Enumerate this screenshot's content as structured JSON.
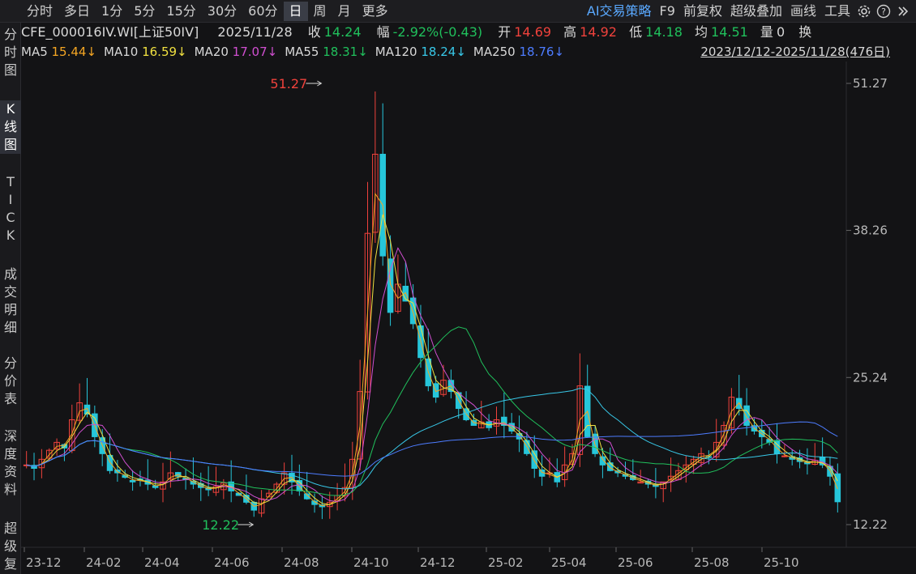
{
  "toolbar": {
    "periods": [
      "分时",
      "多日",
      "1分",
      "5分",
      "15分",
      "30分",
      "60分",
      "日",
      "周",
      "月",
      "更多"
    ],
    "active_period": "日",
    "ai_label": "AI交易策略",
    "f9_label": "F9",
    "fuquan_label": "前复权",
    "overlay_label": "超级叠加",
    "draw_label": "画线",
    "tools_label": "工具",
    "icons": [
      "gear-icon",
      "help-icon",
      "expand-icon"
    ]
  },
  "sidebar": {
    "tabs": [
      "分时图",
      "K线图",
      "TICK",
      "成交明细",
      "分价表",
      "深度资料",
      "超级复"
    ],
    "active": "K线图"
  },
  "info": {
    "symbol": "CFE_000016IV.WI[上证50IV]",
    "date": "2025/11/28",
    "close_label": "收",
    "close": "14.24",
    "change_label": "幅",
    "change": "-2.92%(-0.43)",
    "open_label": "开",
    "open": "14.69",
    "high_label": "高",
    "high": "14.92",
    "low_label": "低",
    "low": "14.18",
    "avg_label": "均",
    "avg": "14.51",
    "vol_label": "量",
    "vol": "0",
    "turnover_label": "换"
  },
  "ma": {
    "items": [
      {
        "label": "MA5",
        "value": "15.44↓",
        "color": "#f5a623"
      },
      {
        "label": "MA10",
        "value": "16.59↓",
        "color": "#f0e040"
      },
      {
        "label": "MA20",
        "value": "17.07↓",
        "color": "#d04fd0"
      },
      {
        "label": "MA55",
        "value": "18.31↓",
        "color": "#20c05c"
      },
      {
        "label": "MA120",
        "value": "18.24↓",
        "color": "#38c8e8"
      },
      {
        "label": "MA250",
        "value": "18.76↓",
        "color": "#4d7cff"
      }
    ],
    "range": "2023/12/12-2025/11/28(476日)"
  },
  "chart_data": {
    "type": "candlestick",
    "y_ticks": [
      "51.27",
      "38.26",
      "25.24",
      "12.22"
    ],
    "ylim": [
      12.22,
      51.27
    ],
    "x_ticks": [
      "23-12",
      "24-02",
      "24-04",
      "24-06",
      "24-08",
      "24-10",
      "24-12",
      "25-02",
      "25-04",
      "25-06",
      "25-08",
      "25-10"
    ],
    "max_label": "51.27",
    "min_label": "12.22",
    "max_value": 51.27,
    "min_value": 12.22,
    "max_index": 0.365,
    "min_index": 0.282,
    "series": [
      {
        "values": [
          17.5,
          17.2,
          18.0,
          18.8,
          19.5,
          19.0,
          21.5,
          23.0,
          22.0,
          20.0,
          18.5,
          17.0,
          16.8,
          16.4,
          16.0,
          16.2,
          15.8,
          15.5,
          16.0,
          16.8,
          16.5,
          16.2,
          15.8,
          15.5,
          15.3,
          15.6,
          15.9,
          15.2,
          14.8,
          14.2,
          13.5,
          14.5,
          15.0,
          15.8,
          16.8,
          16.0,
          15.2,
          14.5,
          14.0,
          13.8,
          14.2,
          14.8,
          15.5,
          18.0,
          24.0,
          38.0,
          45.0,
          36.0,
          31.0,
          33.5,
          32.0,
          30.0,
          27.0,
          24.5,
          23.5,
          25.0,
          24.0,
          22.5,
          21.5,
          21.0,
          21.3,
          20.8,
          21.5,
          21.0,
          20.5,
          19.8,
          18.5,
          17.2,
          16.5,
          16.8,
          16.0,
          17.5,
          18.5,
          24.5,
          20.0,
          18.5,
          17.5,
          17.0,
          16.8,
          16.5,
          16.2,
          16.0,
          15.8,
          15.6,
          16.0,
          16.5,
          17.0,
          17.5,
          18.0,
          18.5,
          18.2,
          19.5,
          21.0,
          23.5,
          22.5,
          21.0,
          20.5,
          20.0,
          19.5,
          18.5,
          18.3,
          18.0,
          17.8,
          17.6,
          17.9,
          17.5,
          16.5,
          14.24
        ]
      }
    ]
  }
}
